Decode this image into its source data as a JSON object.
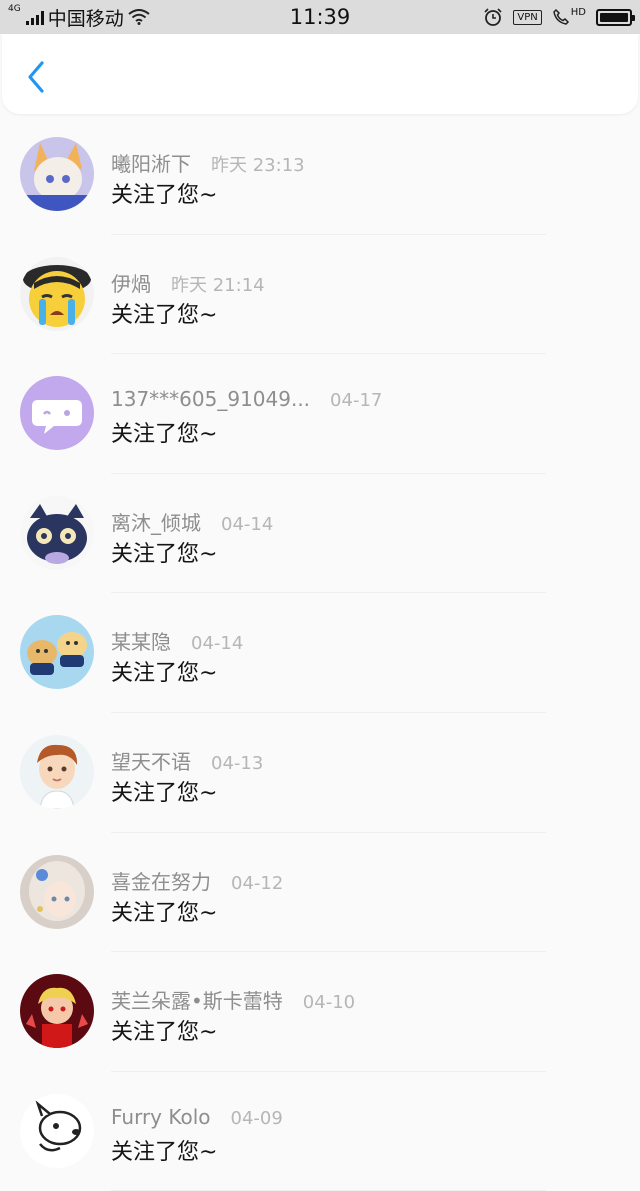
{
  "status_bar": {
    "network": "4G",
    "carrier": "中国移动",
    "time": "11:39",
    "vpn": "VPN",
    "hd": "HD"
  },
  "nav": {
    "back_icon": "chevron-left-icon",
    "accent": "#2196f3"
  },
  "items": [
    {
      "name": "曦阳淅下",
      "time": "昨天 23:13",
      "message": "关注了您~"
    },
    {
      "name": "伊煱",
      "time": "昨天 21:14",
      "message": "关注了您~"
    },
    {
      "name": "137***605_91049...",
      "time": "04-17",
      "message": "关注了您~"
    },
    {
      "name": "离沐_倾城",
      "time": "04-14",
      "message": "关注了您~"
    },
    {
      "name": "某某隐",
      "time": "04-14",
      "message": "关注了您~"
    },
    {
      "name": "望天不语",
      "time": "04-13",
      "message": "关注了您~"
    },
    {
      "name": "喜金在努力",
      "time": "04-12",
      "message": "关注了您~"
    },
    {
      "name": "芙兰朵露•斯卡蕾特",
      "time": "04-10",
      "message": "关注了您~"
    },
    {
      "name": "Furry Kolo",
      "time": "04-09",
      "message": "关注了您~"
    }
  ]
}
